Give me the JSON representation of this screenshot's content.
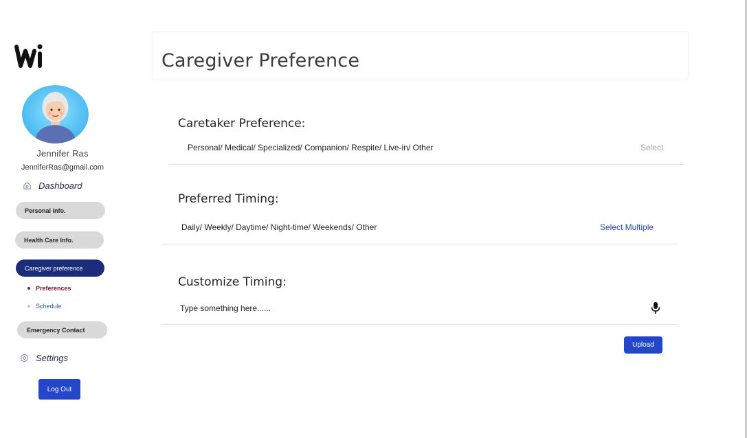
{
  "brand": {
    "logo_text": "Wi",
    "accent": "#2447c9",
    "active_pill": "#1b2c79"
  },
  "user": {
    "name": "Jennifer Ras",
    "email": "JenniferRas@gmail.com"
  },
  "sidebar": {
    "dashboard": {
      "label": "Dashboard",
      "icon": "home-icon"
    },
    "items": [
      {
        "label": "Personal info."
      },
      {
        "label": "Health Care Info."
      },
      {
        "label": "Caregiver preference",
        "active": true
      },
      {
        "label": "Emergency Contact"
      }
    ],
    "subitems": [
      {
        "label": "Preferences",
        "active": true
      },
      {
        "label": "Schedule"
      }
    ],
    "settings": {
      "label": "Settings",
      "icon": "gear-icon"
    },
    "logout_label": "Log Out"
  },
  "main": {
    "title": "Caregiver Preference",
    "sections": {
      "caretaker": {
        "heading": "Caretaker Preference:",
        "options": "Personal/ Medical/ Specialized/ Companion/ Respite/ Live-in/ Other",
        "action": "Select"
      },
      "timing": {
        "heading": "Preferred Timing:",
        "options": "Daily/ Weekly/ Daytime/ Night-time/ Weekends/ Other",
        "action": "Select Multiple"
      },
      "custom": {
        "heading": "Customize Timing:",
        "placeholder": "Type something here......",
        "icon": "microphone-icon"
      }
    },
    "upload_label": "Upload"
  }
}
